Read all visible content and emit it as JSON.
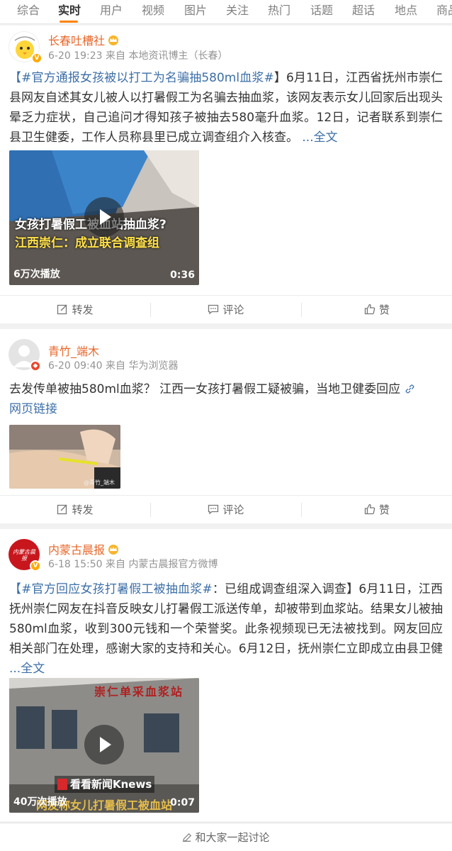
{
  "tabs": [
    "综合",
    "实时",
    "用户",
    "视频",
    "图片",
    "关注",
    "热门",
    "话题",
    "超话",
    "地点",
    "商品"
  ],
  "active_tab": "实时",
  "posts": [
    {
      "user": "长春吐槽社",
      "time": "6-20 19:23",
      "source": "来自 本地资讯博主（长春）",
      "tag": "【#官方通报女孩被以打工为名骗抽580ml血浆#",
      "text": "】6月11日，江西省抚州市崇仁县网友自述其女儿被人以打暑假工为名骗去抽血浆，该网友表示女儿回家后出现头晕乏力症状，自己追问才得知孩子被抽去580毫升血浆。12日，记者联系到崇仁县卫生健委，工作人员称县里已成立调查组介入核查。",
      "more": "...全文",
      "video_caption_1": "女孩打暑假工被血站抽血浆?",
      "video_caption_2": "江西崇仁：成立联合调查组",
      "video_plays": "6万次播放",
      "video_duration": "0:36"
    },
    {
      "user": "青竹_端木",
      "time": "6-20 09:40",
      "source": "来自 华为浏览器",
      "text": "去发传单被抽580ml血浆？ 江西一女孩打暑假工疑被骗，当地卫健委回应",
      "link_label": "网页链接",
      "image_watermark": "@青竹_端木"
    },
    {
      "user": "内蒙古晨报",
      "avatar_text": "内蒙古晨报",
      "time": "6-18 15:50",
      "source": "来自 内蒙古晨报官方微博",
      "tag": "【#官方回应女孩打暑假工被抽血浆#",
      "text": "：已组成调查组深入调查】6月11日，江西抚州崇仁网友在抖音反映女儿打暑假工派送传单，却被带到血浆站。结果女儿被抽580ml血浆，收到300元钱和一个荣誉奖。此条视频现已无法被找到。网友回应相关部门在处理，感谢大家的支持和关心。6月12日，抚州崇仁立即成立由县卫健",
      "more": "...全文",
      "video_sign": "崇仁单采血浆站",
      "video_logo": "看看新闻Knews",
      "video_caption": "网友称女儿打暑假工被血站",
      "video_plays": "40万次播放",
      "video_duration": "0:07"
    }
  ],
  "actions": {
    "repost": "转发",
    "comment": "评论",
    "like": "赞"
  },
  "bottom": {
    "discuss": "和大家一起讨论"
  },
  "colors": {
    "accent": "#ff8200",
    "username": "#e8672a",
    "link": "#3d6fa8",
    "meta": "#939393"
  }
}
